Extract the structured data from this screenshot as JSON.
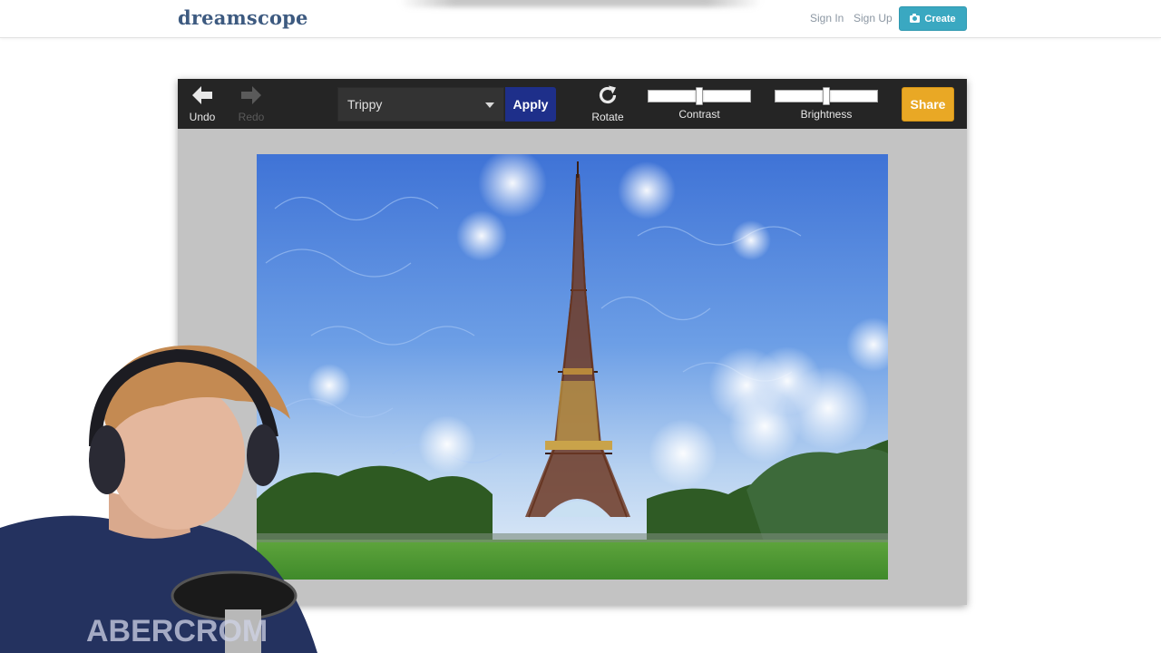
{
  "navbar": {
    "logo": "dreamscope",
    "sign_in": "Sign In",
    "sign_up": "Sign Up",
    "create_label": "Create",
    "create_icon": "camera-icon"
  },
  "toolbar": {
    "undo_label": "Undo",
    "redo_label": "Redo",
    "filter_selected": "Trippy",
    "apply_label": "Apply",
    "rotate_label": "Rotate",
    "contrast_label": "Contrast",
    "contrast_level": 0.5,
    "brightness_label": "Brightness",
    "brightness_level": 0.5,
    "share_label": "Share"
  },
  "colors": {
    "logo": "#3d5a80",
    "create_button": "#3aa8c1",
    "apply_button": "#1e2f8a",
    "share_button": "#e9a825",
    "toolbar_bg": "#252525",
    "canvas_bg": "#c3c3c3"
  },
  "canvas": {
    "subject": "eiffel-tower-deepdream-image"
  },
  "overlay": {
    "webcam_shirt_text": "ABERCROM"
  }
}
